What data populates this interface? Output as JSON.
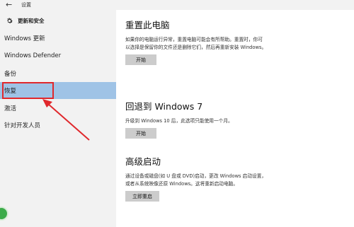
{
  "titlebar": {
    "back": "←",
    "title": "设置"
  },
  "sidebar": {
    "section_title": "更新和安全",
    "items": [
      {
        "label": "Windows 更新"
      },
      {
        "label": "Windows Defender"
      },
      {
        "label": "备份"
      },
      {
        "label": "恢复"
      },
      {
        "label": "激活"
      },
      {
        "label": "针对开发人员"
      }
    ]
  },
  "main": {
    "reset": {
      "title": "重置此电脑",
      "line1": "如果你的电脑运行异常，重置电脑可能会有所帮助。重置时，你可",
      "line2": "以选择是保留你的文件还是删除它们，然后再重新安装 Windows。",
      "button": "开始"
    },
    "rollback": {
      "title": "回退到 Windows 7",
      "line1": "升级到 Windows 10 后，此选项只能使用一个月。",
      "button": "开始"
    },
    "advanced": {
      "title": "高级启动",
      "line1": "通过设备或磁盘(如 U 盘或 DVD)启动，更改 Windows 启动设置，",
      "line2": "或者从系统映像还原 Windows。这将重新启动电脑。",
      "button": "立即重启"
    }
  },
  "colors": {
    "active_item": "#9fc3e6",
    "annotation": "#e0282c",
    "button_bg": "#cccccc"
  }
}
